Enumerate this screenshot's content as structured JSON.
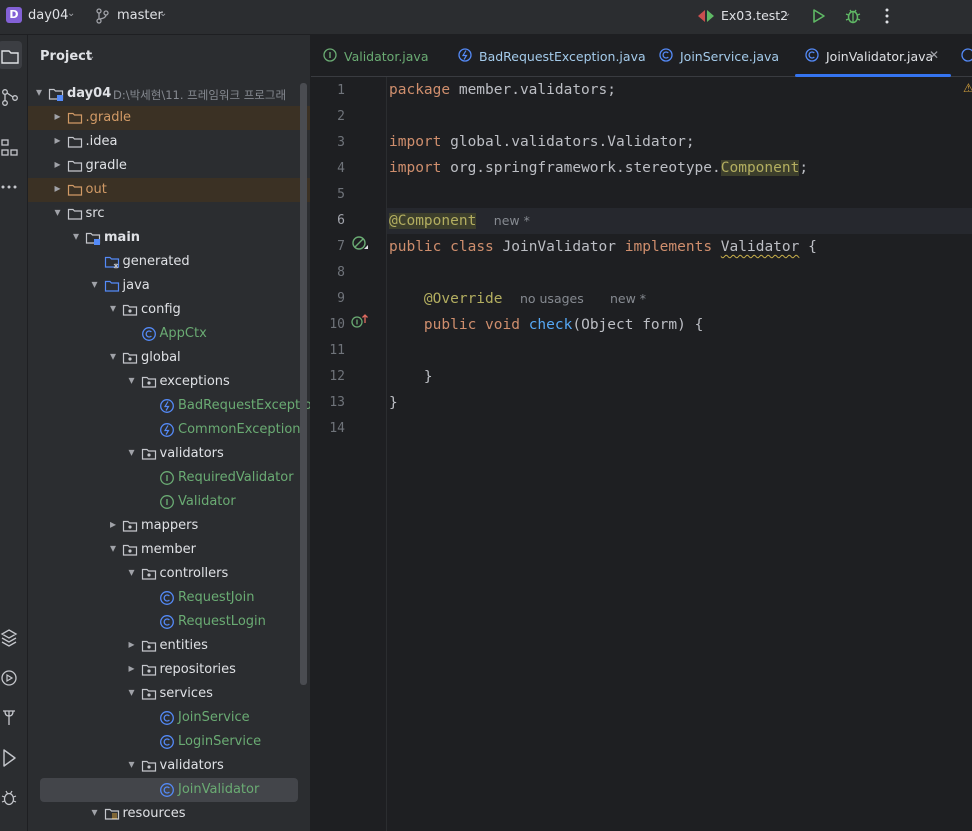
{
  "titlebar": {
    "project_initial": "D",
    "project_name": "day04",
    "branch": "master",
    "run_config": "Ex03.test2"
  },
  "project_panel": {
    "title": "Project",
    "tree": [
      {
        "label": "day04",
        "hint": "D:\\박세현\\11. 프레임워크 프로그래",
        "depth": 0,
        "arrow": "down",
        "icon": "module-folder-icon",
        "bold": true
      },
      {
        "label": ".gradle",
        "depth": 1,
        "arrow": "right",
        "icon": "excluded-folder-icon",
        "excluded": true
      },
      {
        "label": ".idea",
        "depth": 1,
        "arrow": "right",
        "icon": "folder-icon"
      },
      {
        "label": "gradle",
        "depth": 1,
        "arrow": "right",
        "icon": "folder-icon"
      },
      {
        "label": "out",
        "depth": 1,
        "arrow": "right",
        "icon": "excluded-folder-icon",
        "excluded": true
      },
      {
        "label": "src",
        "depth": 1,
        "arrow": "down",
        "icon": "folder-icon"
      },
      {
        "label": "main",
        "depth": 2,
        "arrow": "down",
        "icon": "module-folder-icon",
        "bold": true
      },
      {
        "label": "generated",
        "depth": 3,
        "arrow": "",
        "icon": "generated-folder-icon"
      },
      {
        "label": "java",
        "depth": 3,
        "arrow": "down",
        "icon": "source-folder-icon"
      },
      {
        "label": "config",
        "depth": 4,
        "arrow": "down",
        "icon": "package-icon"
      },
      {
        "label": "AppCtx",
        "depth": 5,
        "arrow": "",
        "icon": "class-icon",
        "cls": true
      },
      {
        "label": "global",
        "depth": 4,
        "arrow": "down",
        "icon": "package-icon"
      },
      {
        "label": "exceptions",
        "depth": 5,
        "arrow": "down",
        "icon": "package-icon"
      },
      {
        "label": "BadRequestException",
        "depth": 6,
        "arrow": "",
        "icon": "exception-class-icon",
        "cls": true
      },
      {
        "label": "CommonException",
        "depth": 6,
        "arrow": "",
        "icon": "exception-class-icon",
        "cls": true
      },
      {
        "label": "validators",
        "depth": 5,
        "arrow": "down",
        "icon": "package-icon"
      },
      {
        "label": "RequiredValidator",
        "depth": 6,
        "arrow": "",
        "icon": "interface-icon",
        "cls": true
      },
      {
        "label": "Validator",
        "depth": 6,
        "arrow": "",
        "icon": "interface-icon",
        "cls": true
      },
      {
        "label": "mappers",
        "depth": 4,
        "arrow": "right",
        "icon": "package-icon"
      },
      {
        "label": "member",
        "depth": 4,
        "arrow": "down",
        "icon": "package-icon"
      },
      {
        "label": "controllers",
        "depth": 5,
        "arrow": "down",
        "icon": "package-icon"
      },
      {
        "label": "RequestJoin",
        "depth": 6,
        "arrow": "",
        "icon": "class-icon",
        "cls": true
      },
      {
        "label": "RequestLogin",
        "depth": 6,
        "arrow": "",
        "icon": "class-icon",
        "cls": true
      },
      {
        "label": "entities",
        "depth": 5,
        "arrow": "right",
        "icon": "package-icon"
      },
      {
        "label": "repositories",
        "depth": 5,
        "arrow": "right",
        "icon": "package-icon"
      },
      {
        "label": "services",
        "depth": 5,
        "arrow": "down",
        "icon": "package-icon"
      },
      {
        "label": "JoinService",
        "depth": 6,
        "arrow": "",
        "icon": "class-icon",
        "cls": true
      },
      {
        "label": "LoginService",
        "depth": 6,
        "arrow": "",
        "icon": "class-icon",
        "cls": true
      },
      {
        "label": "validators",
        "depth": 5,
        "arrow": "down",
        "icon": "package-icon"
      },
      {
        "label": "JoinValidator",
        "depth": 6,
        "arrow": "",
        "icon": "class-icon",
        "cls": true,
        "selected": true
      },
      {
        "label": "resources",
        "depth": 3,
        "arrow": "down",
        "icon": "resources-folder-icon"
      }
    ]
  },
  "editor": {
    "tabs": [
      {
        "label": "Validator.java",
        "icon": "interface-icon",
        "iface": true
      },
      {
        "label": "BadRequestException.java",
        "icon": "exception-class-icon"
      },
      {
        "label": "JoinService.java",
        "icon": "class-icon"
      },
      {
        "label": "JoinValidator.java",
        "icon": "class-icon",
        "active": true
      }
    ],
    "line_numbers": [
      "1",
      "2",
      "3",
      "4",
      "5",
      "6",
      "7",
      "8",
      "9",
      "10",
      "11",
      "12",
      "13",
      "14"
    ],
    "current_line": 6,
    "code": {
      "l1_kw": "package",
      "l1_rest": " member.validators;",
      "l3_kw": "import",
      "l3_rest": " global.validators.Validator;",
      "l4_kw": "import",
      "l4_rest": " org.springframework.stereotype.",
      "l4_ann": "Component",
      "l4_end": ";",
      "l6_ann": "@Component",
      "l6_hint": "new *",
      "l7_kw1": "public",
      "l7_kw2": "class",
      "l7_name": "JoinValidator",
      "l7_kw3": "implements",
      "l7_iface": "Validator",
      "l7_end": " {",
      "l9_ann": "@Override",
      "l9_hint1": "no usages",
      "l9_hint2": "new *",
      "l10_kw1": "public",
      "l10_kw2": "void",
      "l10_fn": "check",
      "l10_rest": "(Object form) {",
      "l12": "}",
      "l13": "}"
    }
  }
}
